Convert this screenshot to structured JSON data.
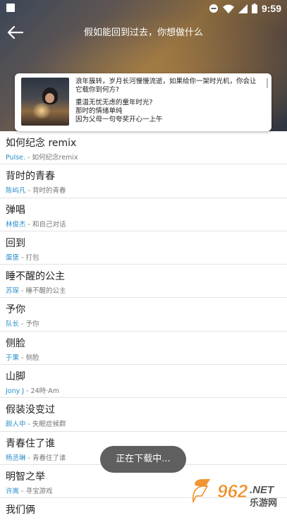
{
  "status_bar": {
    "time": "9:59",
    "icons": [
      "notification-square-icon",
      "do-not-disturb-icon",
      "wifi-icon",
      "signal-icon",
      "battery-icon"
    ]
  },
  "toolbar": {
    "title": "假如能回到过去，你想做什么",
    "back_icon": "back-arrow-icon"
  },
  "card": {
    "line1": "浪年簇转，岁月长河慢慢流逝，如果给你一架时光机，你会让",
    "line2": "它载你到何方?",
    "line3": "重温无忧无虑的童年时光?",
    "line4": "那时的情绪单纯",
    "line5": "因为父母一句夸奖开心一上午"
  },
  "songs": [
    {
      "title": "如何纪念 remix",
      "artist": "Pulse.",
      "album": " - 如何纪念remix"
    },
    {
      "title": "背时的青春",
      "artist": "陈屿凡",
      "album": " - 背时的青春"
    },
    {
      "title": "弹唱",
      "artist": "林俊杰",
      "album": " - 和自己对话"
    },
    {
      "title": "回到",
      "artist": "蛋堡",
      "album": " - 打包"
    },
    {
      "title": "睡不醒的公主",
      "artist": "苏琛",
      "album": " - 睡不醒的公主"
    },
    {
      "title": "予你",
      "artist": "队长",
      "album": " - 予你"
    },
    {
      "title": "侧脸",
      "artist": "于果",
      "album": " - 侧脸"
    },
    {
      "title": "山脚",
      "artist": "Jony J",
      "album": " - 24時·Am"
    },
    {
      "title": "假装没变过",
      "artist": "颜人中",
      "album": " - 失眠症候群"
    },
    {
      "title": "青春住了谁",
      "artist": "杨丞琳",
      "album": " - 青春住了谁"
    },
    {
      "title": "明智之举",
      "artist": "许嵩",
      "album": " - 寻宝游戏"
    },
    {
      "title": "我们俩",
      "artist": "",
      "album": ""
    }
  ],
  "toast": "正在下载中...",
  "watermark": {
    "main": "962.NET",
    "sub": "乐游网"
  },
  "colors": {
    "artist": "#2a8fc9",
    "toast_bg": "#5f5f5f",
    "watermark_orange": "#f08a1c"
  }
}
